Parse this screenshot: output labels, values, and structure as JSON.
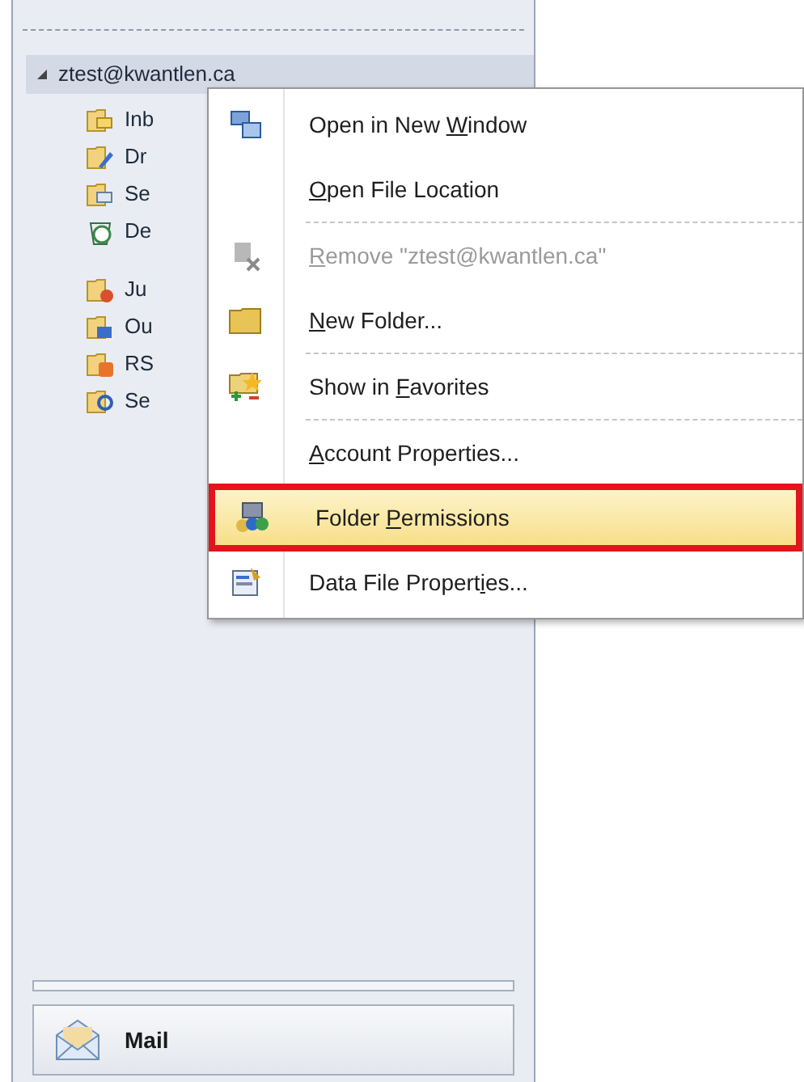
{
  "nav_pane": {
    "account": {
      "label": "ztest@kwantlen.ca",
      "expanded": true
    },
    "folders": [
      {
        "label": "Inb",
        "kind": "inbox"
      },
      {
        "label": "Dr",
        "kind": "drafts"
      },
      {
        "label": "Se",
        "kind": "sent"
      },
      {
        "label": "De",
        "kind": "deleted"
      },
      {
        "label": "Ju",
        "kind": "junk",
        "group_start": true
      },
      {
        "label": "Ou",
        "kind": "outbox"
      },
      {
        "label": "RS",
        "kind": "rss"
      },
      {
        "label": "Se",
        "kind": "search"
      }
    ],
    "mail_button": {
      "label": "Mail"
    }
  },
  "context_menu": {
    "items": [
      {
        "pre": "Open in New ",
        "key": "W",
        "post": "indow",
        "kind": "windows",
        "disabled": false,
        "selected": false
      },
      {
        "key": "O",
        "post": "pen File Location",
        "kind": "none",
        "disabled": false,
        "selected": false,
        "separator_after": true
      },
      {
        "key": "R",
        "post": "emove \"ztest@kwantlen.ca\"",
        "kind": "remove",
        "disabled": true,
        "selected": false
      },
      {
        "key": "N",
        "post": "ew Folder...",
        "kind": "folder",
        "disabled": false,
        "selected": false,
        "separator_after": true
      },
      {
        "pre": "Show in ",
        "key": "F",
        "post": "avorites",
        "kind": "favorites",
        "disabled": false,
        "selected": false,
        "separator_after": true
      },
      {
        "key": "A",
        "post": "ccount Properties...",
        "kind": "none",
        "disabled": false,
        "selected": false
      },
      {
        "pre": "Folder ",
        "key": "P",
        "post": "ermissions",
        "kind": "permissions",
        "disabled": false,
        "selected": true
      },
      {
        "pre": "Data File Propert",
        "key": "i",
        "post": "es...",
        "kind": "properties",
        "disabled": false,
        "selected": false
      }
    ]
  }
}
